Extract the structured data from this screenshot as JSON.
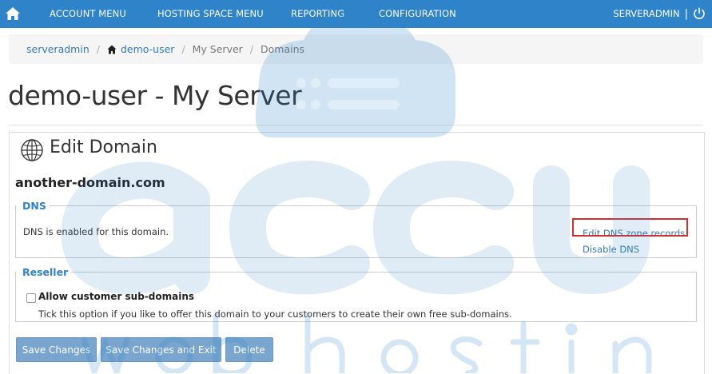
{
  "topbar": {
    "menu": [
      {
        "label": "ACCOUNT MENU"
      },
      {
        "label": "HOSTING SPACE MENU"
      },
      {
        "label": "REPORTING"
      },
      {
        "label": "CONFIGURATION"
      }
    ],
    "user": "SERVERADMIN",
    "separator": "|"
  },
  "breadcrumb": {
    "items": [
      {
        "label": "serveradmin"
      },
      {
        "label": "demo-user"
      },
      {
        "label": "My Server"
      },
      {
        "label": "Domains"
      }
    ],
    "separator": "/"
  },
  "page": {
    "title": "demo-user - My Server"
  },
  "panel": {
    "title": "Edit Domain",
    "domain": "another-domain.com",
    "dns": {
      "legend": "DNS",
      "status": "DNS is enabled for this domain.",
      "edit_link": "Edit DNS zone records",
      "disable_link": "Disable DNS"
    },
    "reseller": {
      "legend": "Reseller",
      "checkbox_label": "Allow customer sub-domains",
      "checkbox_checked": false,
      "help": "Tick this option if you like to offer this domain to your customers to create their own free sub-domains."
    }
  },
  "buttons": {
    "save": "Save Changes",
    "save_exit": "Save Changes and Exit",
    "delete": "Delete"
  },
  "colors": {
    "topbar": "#2f83c9",
    "link": "#337ab7",
    "legend": "#2f83c9",
    "button": "#79a5cf",
    "highlight": "#d32f2f"
  }
}
